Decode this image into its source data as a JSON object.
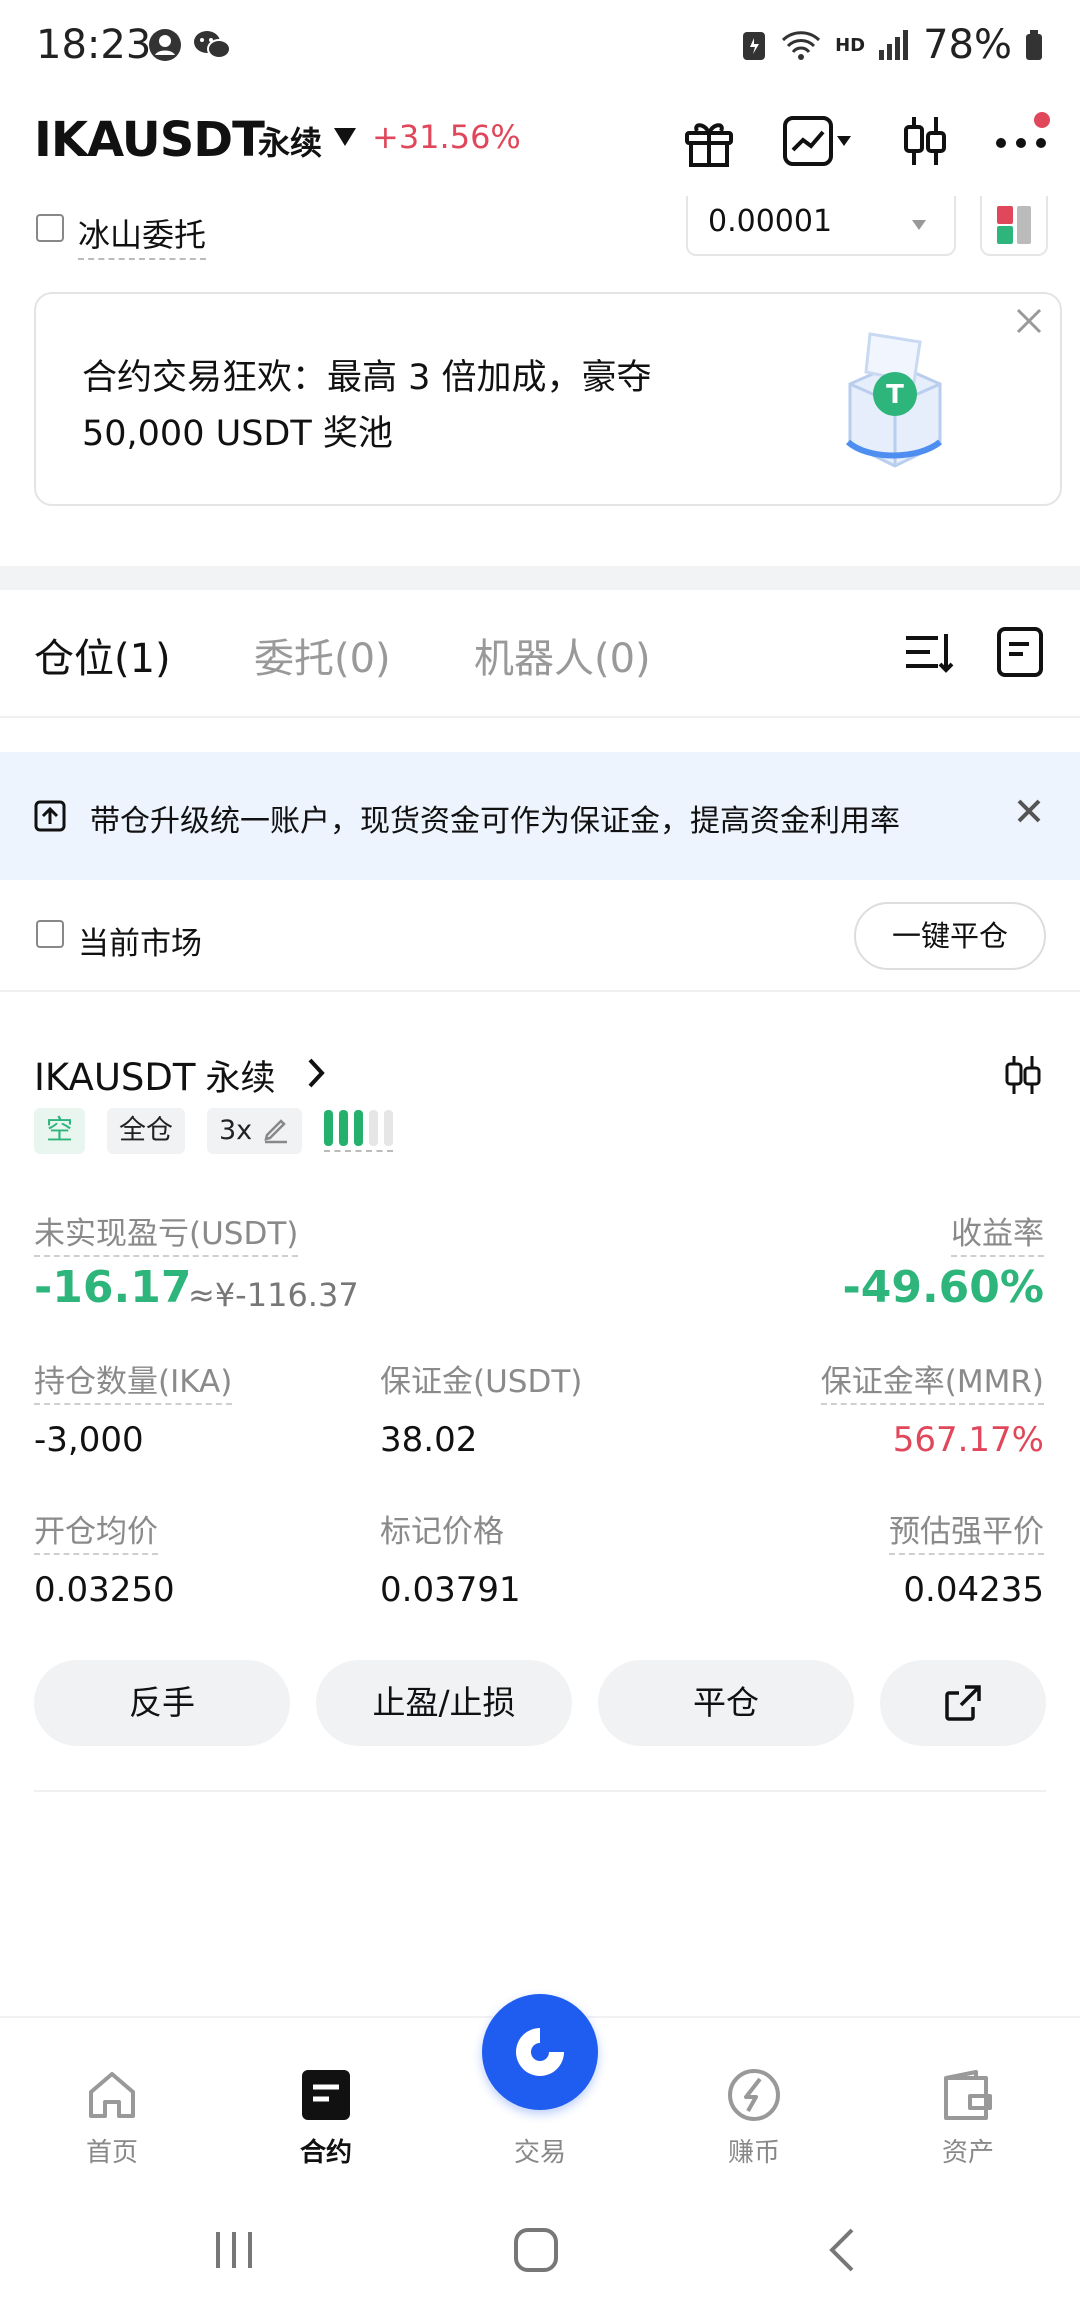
{
  "status": {
    "time": "18:23",
    "hd": "HD",
    "battery": "78%"
  },
  "header": {
    "pair": "IKAUSDT",
    "type": "永续",
    "change": "+31.56%"
  },
  "order": {
    "iceberg_label": "冰山委托",
    "price_step": "0.00001"
  },
  "banner": {
    "line1": "合约交易狂欢：最高 3 倍加成，豪夺",
    "line2": "50,000 USDT 奖池"
  },
  "tabs": [
    {
      "label": "仓位(1)"
    },
    {
      "label": "委托(0)"
    },
    {
      "label": "机器人(0)"
    }
  ],
  "upgrade": {
    "text": "带仓升级统一账户，现货资金可作为保证金，提高资金利用率"
  },
  "market": {
    "current_market_label": "当前市场",
    "close_all_label": "一键平仓"
  },
  "position": {
    "pair": "IKAUSDT",
    "type": "永续",
    "side": "空",
    "margin_mode": "全仓",
    "leverage": "3x",
    "risk_level": 0.6,
    "pnl_label": "未实现盈亏(USDT)",
    "pnl": "-16.17",
    "pnl_cny": "≈¥-116.37",
    "roe_label": "收益率",
    "roe": "-49.60%",
    "size_label": "持仓数量(IKA)",
    "size": "-3,000",
    "margin_label": "保证金(USDT)",
    "margin": "38.02",
    "mmr_label": "保证金率(MMR)",
    "mmr": "567.17%",
    "entry_label": "开仓均价",
    "entry": "0.03250",
    "mark_label": "标记价格",
    "mark": "0.03791",
    "liq_label": "预估强平价",
    "liq": "0.04235"
  },
  "actions": {
    "reverse": "反手",
    "tpsl": "止盈/止损",
    "close": "平仓"
  },
  "nav": {
    "home": "首页",
    "futures": "合约",
    "trade": "交易",
    "earn": "赚币",
    "assets": "资产"
  },
  "colors": {
    "up_green": "#2eb57c",
    "down_red": "#e0475a",
    "brand_blue": "#1f5cf0"
  }
}
